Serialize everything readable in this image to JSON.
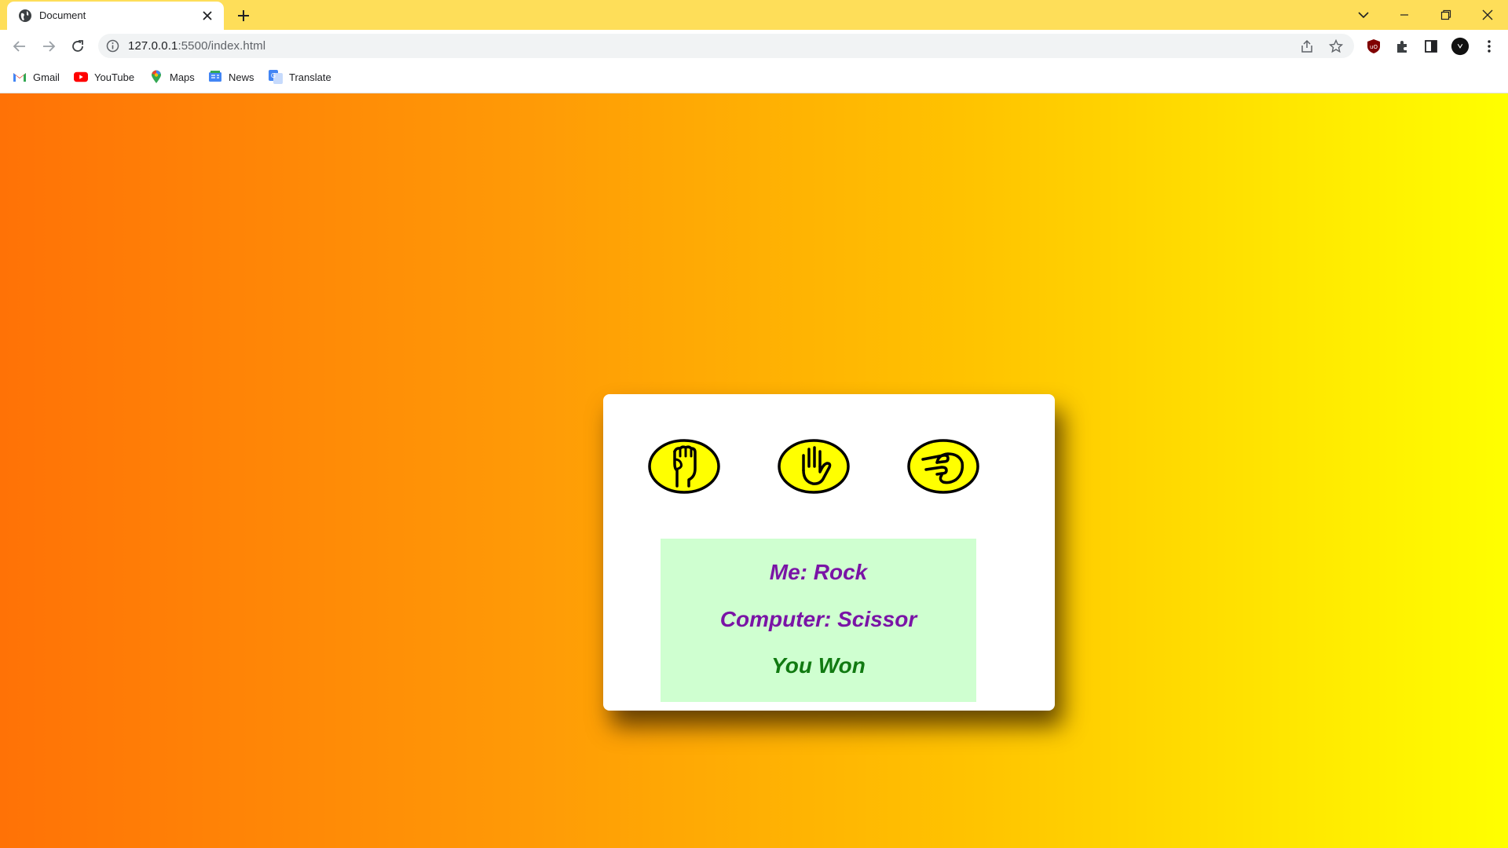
{
  "browser": {
    "tab": {
      "title": "Document"
    },
    "url_host": "127.0.0.1",
    "url_path": ":5500/index.html",
    "bookmarks": [
      {
        "label": "Gmail",
        "icon": "gmail-icon"
      },
      {
        "label": "YouTube",
        "icon": "youtube-icon"
      },
      {
        "label": "Maps",
        "icon": "maps-icon"
      },
      {
        "label": "News",
        "icon": "news-icon"
      },
      {
        "label": "Translate",
        "icon": "translate-icon"
      }
    ],
    "colors": {
      "tabbar": "#fede59",
      "omnibox": "#f1f3f4"
    }
  },
  "game": {
    "choices": [
      {
        "name": "rock",
        "icon": "fist-icon"
      },
      {
        "name": "paper",
        "icon": "open-hand-icon"
      },
      {
        "name": "scissor",
        "icon": "scissor-hand-icon"
      }
    ],
    "result": {
      "me": "Me: Rock",
      "computer": "Computer: Scissor",
      "outcome": "You Won"
    },
    "colors": {
      "gradient_start": "#ff7206",
      "gradient_end": "#ffff00",
      "choice_fill": "#ffff00",
      "result_bg": "#cfffd0",
      "pick_text": "#7a14a6",
      "outcome_text": "#117a11"
    }
  }
}
